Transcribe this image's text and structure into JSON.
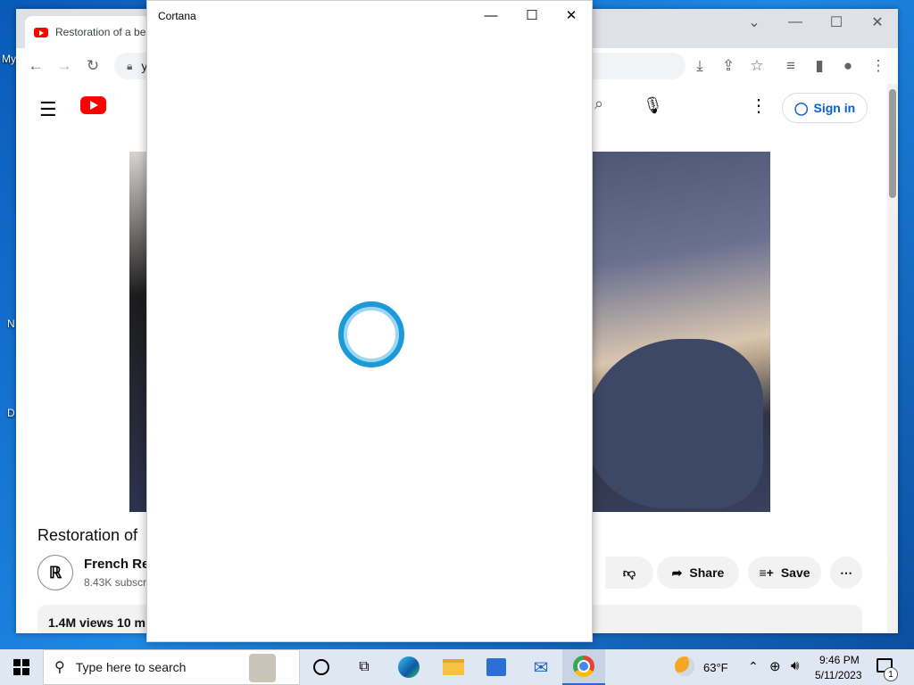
{
  "desktop": {
    "icon_labels": [
      "My",
      "N",
      "D"
    ]
  },
  "chrome": {
    "tab_title": "Restoration of a bea",
    "omnibox_text": "y",
    "controls": {
      "minimize": "—",
      "maximize": "☐",
      "close": "✕"
    }
  },
  "youtube": {
    "sign_in": "Sign in",
    "video_title": "Restoration of",
    "channel_name": "French Re",
    "subscribers": "8.43K subscr",
    "share_label": "Share",
    "save_label": "Save",
    "views": "1.4M views  10 m"
  },
  "cortana": {
    "title": "Cortana"
  },
  "taskbar": {
    "search_placeholder": "Type here to search",
    "weather": "63°F",
    "time": "9:46 PM",
    "date": "5/11/2023",
    "notification_count": "1"
  },
  "colors": {
    "cortana_ring": "#1a9ad9",
    "youtube_red": "#ff0000",
    "signin_blue": "#065fd4",
    "taskbar_bg": "#dfe7f2"
  }
}
